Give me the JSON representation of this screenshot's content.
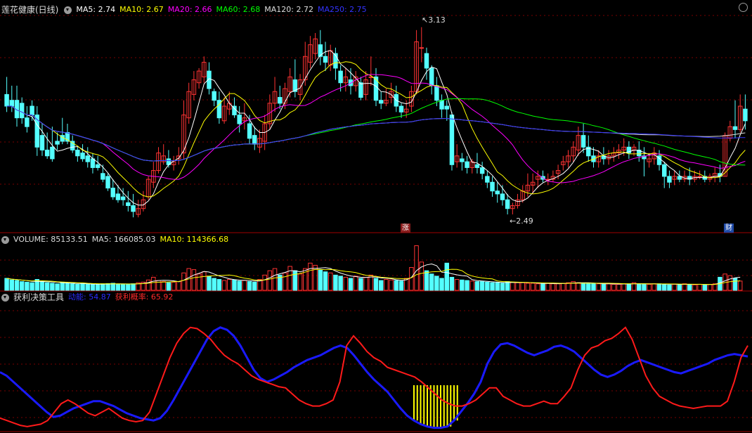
{
  "price_panel": {
    "stock_name": "莲花健康(日线)",
    "ma_legend": [
      {
        "label": "MA5: 2.74",
        "color": "#ffffff"
      },
      {
        "label": "MA10: 2.67",
        "color": "#ffff00"
      },
      {
        "label": "MA20: 2.66",
        "color": "#ff00ff"
      },
      {
        "label": "MA60: 2.68",
        "color": "#00ff00"
      },
      {
        "label": "MA120: 2.72",
        "color": "#dddddd"
      },
      {
        "label": "MA250: 2.75",
        "color": "#3333ff"
      }
    ],
    "high_label": "3.13",
    "low_label": "2.49",
    "badge_up": "涨",
    "badge_fin": "财"
  },
  "volume_panel": {
    "title": "VOLUME: 85133.51",
    "ma5": "MA5: 166085.03",
    "ma10": "MA10: 114366.68"
  },
  "indicator_panel": {
    "title": "获利决策工具",
    "momentum": "动能: 54.87",
    "profit_prob": "获利概率: 65.92"
  },
  "colors": {
    "up": "#ff3333",
    "down": "#54ffff",
    "grid": "#7a0000",
    "blue_line": "#1a1aff",
    "red_line": "#ff1a1a",
    "signal": "#ffff00"
  },
  "chart_data": {
    "type": "candlestick",
    "price_ylim": [
      2.43,
      3.17
    ],
    "volume_ymax": 420000,
    "osc_ylim": [
      0,
      100
    ],
    "candles": [
      [
        2.9,
        2.96,
        2.86,
        2.84
      ],
      [
        2.88,
        2.93,
        2.86,
        2.84
      ],
      [
        2.88,
        2.93,
        2.82,
        2.79
      ],
      [
        2.87,
        2.89,
        2.82,
        2.8
      ],
      [
        2.82,
        2.86,
        2.79,
        2.77
      ],
      [
        2.86,
        2.88,
        2.83,
        2.81
      ],
      [
        2.83,
        2.86,
        2.72,
        2.69
      ],
      [
        2.76,
        2.8,
        2.71,
        2.69
      ],
      [
        2.71,
        2.77,
        2.69,
        2.68
      ],
      [
        2.72,
        2.79,
        2.68,
        2.67
      ],
      [
        2.74,
        2.77,
        2.73,
        2.71
      ],
      [
        2.76,
        2.82,
        2.74,
        2.73
      ],
      [
        2.77,
        2.8,
        2.74,
        2.73
      ],
      [
        2.74,
        2.76,
        2.71,
        2.7
      ],
      [
        2.71,
        2.72,
        2.69,
        2.67
      ],
      [
        2.7,
        2.73,
        2.68,
        2.67
      ],
      [
        2.69,
        2.72,
        2.67,
        2.65
      ],
      [
        2.68,
        2.7,
        2.65,
        2.63
      ],
      [
        2.66,
        2.69,
        2.65,
        2.64
      ],
      [
        2.63,
        2.66,
        2.61,
        2.6
      ],
      [
        2.62,
        2.63,
        2.58,
        2.57
      ],
      [
        2.58,
        2.61,
        2.55,
        2.54
      ],
      [
        2.56,
        2.59,
        2.54,
        2.53
      ],
      [
        2.55,
        2.58,
        2.54,
        2.52
      ],
      [
        2.53,
        2.57,
        2.52,
        2.5
      ],
      [
        2.52,
        2.56,
        2.5,
        2.48
      ],
      [
        2.49,
        2.54,
        2.51,
        2.48
      ],
      [
        2.51,
        2.57,
        2.54,
        2.5
      ],
      [
        2.55,
        2.62,
        2.61,
        2.54
      ],
      [
        2.6,
        2.67,
        2.64,
        2.58
      ],
      [
        2.64,
        2.72,
        2.7,
        2.63
      ],
      [
        2.67,
        2.73,
        2.69,
        2.66
      ],
      [
        2.68,
        2.71,
        2.66,
        2.65
      ],
      [
        2.66,
        2.69,
        2.67,
        2.64
      ],
      [
        2.68,
        2.72,
        2.69,
        2.66
      ],
      [
        2.7,
        2.88,
        2.83,
        2.68
      ],
      [
        2.82,
        2.94,
        2.91,
        2.8
      ],
      [
        2.9,
        2.98,
        2.95,
        2.88
      ],
      [
        2.94,
        2.99,
        2.98,
        2.92
      ],
      [
        2.96,
        3.03,
        3.01,
        2.94
      ],
      [
        2.98,
        3.01,
        2.92,
        2.9
      ],
      [
        2.91,
        2.92,
        2.88,
        2.86
      ],
      [
        2.88,
        2.91,
        2.82,
        2.8
      ],
      [
        2.81,
        2.89,
        2.86,
        2.8
      ],
      [
        2.85,
        2.91,
        2.87,
        2.83
      ],
      [
        2.86,
        2.89,
        2.83,
        2.82
      ],
      [
        2.83,
        2.86,
        2.8,
        2.77
      ],
      [
        2.81,
        2.87,
        2.82,
        2.78
      ],
      [
        2.8,
        2.83,
        2.75,
        2.73
      ],
      [
        2.76,
        2.79,
        2.73,
        2.71
      ],
      [
        2.72,
        2.78,
        2.75,
        2.7
      ],
      [
        2.74,
        2.83,
        2.8,
        2.71
      ],
      [
        2.8,
        2.9,
        2.87,
        2.78
      ],
      [
        2.87,
        2.96,
        2.91,
        2.84
      ],
      [
        2.89,
        2.93,
        2.87,
        2.85
      ],
      [
        2.87,
        2.94,
        2.92,
        2.85
      ],
      [
        2.91,
        2.99,
        2.96,
        2.89
      ],
      [
        2.95,
        3.02,
        2.91,
        2.89
      ],
      [
        2.9,
        2.97,
        2.95,
        2.88
      ],
      [
        2.95,
        3.08,
        3.03,
        2.93
      ],
      [
        3.01,
        3.1,
        3.07,
        2.99
      ],
      [
        3.04,
        3.11,
        3.09,
        3.02
      ],
      [
        3.07,
        3.12,
        3.03,
        3.0
      ],
      [
        3.03,
        3.08,
        3.01,
        2.98
      ],
      [
        3.0,
        3.07,
        3.05,
        2.98
      ],
      [
        3.04,
        3.06,
        2.99,
        2.95
      ],
      [
        2.98,
        3.0,
        2.94,
        2.91
      ],
      [
        2.94,
        2.99,
        2.96,
        2.91
      ],
      [
        2.95,
        2.99,
        2.93,
        2.9
      ],
      [
        2.93,
        2.98,
        2.96,
        2.91
      ],
      [
        2.94,
        2.96,
        2.89,
        2.88
      ],
      [
        2.9,
        2.98,
        2.95,
        2.88
      ],
      [
        2.96,
        3.03,
        2.96,
        2.93
      ],
      [
        2.96,
        2.99,
        2.88,
        2.86
      ],
      [
        2.88,
        2.91,
        2.87,
        2.85
      ],
      [
        2.87,
        2.92,
        2.88,
        2.86
      ],
      [
        2.89,
        2.94,
        2.91,
        2.87
      ],
      [
        2.9,
        2.93,
        2.86,
        2.84
      ],
      [
        2.86,
        2.87,
        2.84,
        2.82
      ],
      [
        2.84,
        2.88,
        2.85,
        2.82
      ],
      [
        2.86,
        2.93,
        2.91,
        2.84
      ],
      [
        2.91,
        3.12,
        3.08,
        2.9
      ],
      [
        3.06,
        3.13,
        3.06,
        3.01
      ],
      [
        3.04,
        3.06,
        2.99,
        2.95
      ],
      [
        2.99,
        3.0,
        2.93,
        2.9
      ],
      [
        2.93,
        2.96,
        2.88,
        2.86
      ],
      [
        2.88,
        2.9,
        2.85,
        2.82
      ],
      [
        2.86,
        2.88,
        2.85,
        2.81
      ],
      [
        2.83,
        2.84,
        2.66,
        2.64
      ],
      [
        2.67,
        2.73,
        2.69,
        2.65
      ],
      [
        2.68,
        2.7,
        2.67,
        2.64
      ],
      [
        2.67,
        2.69,
        2.65,
        2.63
      ],
      [
        2.65,
        2.68,
        2.67,
        2.63
      ],
      [
        2.66,
        2.7,
        2.65,
        2.63
      ],
      [
        2.65,
        2.67,
        2.63,
        2.61
      ],
      [
        2.62,
        2.64,
        2.6,
        2.58
      ],
      [
        2.6,
        2.62,
        2.57,
        2.55
      ],
      [
        2.57,
        2.6,
        2.56,
        2.53
      ],
      [
        2.56,
        2.59,
        2.54,
        2.52
      ],
      [
        2.54,
        2.56,
        2.51,
        2.49
      ],
      [
        2.51,
        2.53,
        2.52,
        2.49
      ],
      [
        2.52,
        2.56,
        2.54,
        2.51
      ],
      [
        2.54,
        2.59,
        2.57,
        2.53
      ],
      [
        2.57,
        2.63,
        2.59,
        2.55
      ],
      [
        2.59,
        2.63,
        2.6,
        2.56
      ],
      [
        2.61,
        2.64,
        2.62,
        2.58
      ],
      [
        2.62,
        2.64,
        2.61,
        2.6
      ],
      [
        2.61,
        2.63,
        2.61,
        2.59
      ],
      [
        2.61,
        2.64,
        2.62,
        2.6
      ],
      [
        2.63,
        2.66,
        2.64,
        2.61
      ],
      [
        2.66,
        2.69,
        2.67,
        2.64
      ],
      [
        2.67,
        2.71,
        2.69,
        2.65
      ],
      [
        2.69,
        2.74,
        2.72,
        2.67
      ],
      [
        2.71,
        2.79,
        2.76,
        2.69
      ],
      [
        2.76,
        2.8,
        2.72,
        2.7
      ],
      [
        2.72,
        2.76,
        2.69,
        2.67
      ],
      [
        2.69,
        2.72,
        2.67,
        2.65
      ],
      [
        2.67,
        2.71,
        2.69,
        2.65
      ],
      [
        2.69,
        2.72,
        2.68,
        2.66
      ],
      [
        2.68,
        2.71,
        2.69,
        2.66
      ],
      [
        2.69,
        2.72,
        2.7,
        2.67
      ],
      [
        2.7,
        2.73,
        2.71,
        2.68
      ],
      [
        2.71,
        2.75,
        2.72,
        2.69
      ],
      [
        2.72,
        2.74,
        2.7,
        2.68
      ],
      [
        2.71,
        2.73,
        2.72,
        2.69
      ],
      [
        2.71,
        2.74,
        2.69,
        2.67
      ],
      [
        2.69,
        2.72,
        2.68,
        2.62
      ],
      [
        2.67,
        2.7,
        2.68,
        2.65
      ],
      [
        2.68,
        2.72,
        2.7,
        2.66
      ],
      [
        2.69,
        2.71,
        2.66,
        2.64
      ],
      [
        2.66,
        2.67,
        2.62,
        2.58
      ],
      [
        2.62,
        2.64,
        2.6,
        2.58
      ],
      [
        2.61,
        2.64,
        2.62,
        2.59
      ],
      [
        2.62,
        2.64,
        2.61,
        2.6
      ],
      [
        2.61,
        2.64,
        2.62,
        2.6
      ],
      [
        2.62,
        2.65,
        2.61,
        2.59
      ],
      [
        2.61,
        2.64,
        2.62,
        2.6
      ],
      [
        2.62,
        2.64,
        2.62,
        2.61
      ],
      [
        2.62,
        2.64,
        2.61,
        2.6
      ],
      [
        2.61,
        2.63,
        2.62,
        2.6
      ],
      [
        2.62,
        2.65,
        2.63,
        2.6
      ],
      [
        2.63,
        2.66,
        2.62,
        2.6
      ],
      [
        2.62,
        2.77,
        2.76,
        2.62
      ],
      [
        2.75,
        2.81,
        2.79,
        2.74
      ],
      [
        2.79,
        2.88,
        2.78,
        2.75
      ],
      [
        2.78,
        2.9,
        2.86,
        2.77
      ],
      [
        2.85,
        2.9,
        2.81,
        2.78
      ]
    ],
    "volume": [
      110000,
      95000,
      90000,
      80000,
      75000,
      70000,
      100000,
      80000,
      70000,
      65000,
      60000,
      75000,
      65000,
      60000,
      55000,
      58000,
      60000,
      55000,
      52000,
      60000,
      62000,
      65000,
      58000,
      55000,
      55000,
      60000,
      70000,
      75000,
      95000,
      120000,
      90000,
      80000,
      70000,
      75000,
      80000,
      160000,
      200000,
      190000,
      150000,
      170000,
      130000,
      110000,
      100000,
      90000,
      100000,
      95000,
      85000,
      90000,
      80000,
      75000,
      100000,
      140000,
      180000,
      200000,
      140000,
      160000,
      220000,
      180000,
      150000,
      200000,
      250000,
      230000,
      190000,
      170000,
      160000,
      140000,
      130000,
      120000,
      110000,
      130000,
      110000,
      120000,
      140000,
      110000,
      90000,
      100000,
      95000,
      90000,
      85000,
      110000,
      210000,
      410000,
      260000,
      180000,
      150000,
      130000,
      110000,
      250000,
      120000,
      100000,
      95000,
      90000,
      85000,
      80000,
      80000,
      75000,
      70000,
      70000,
      65000,
      80000,
      75000,
      70000,
      70000,
      65000,
      65000,
      60000,
      60000,
      65000,
      60000,
      60000,
      65000,
      70000,
      80000,
      70000,
      65000,
      60000,
      60000,
      60000,
      60000,
      60000,
      55000,
      55000,
      60000,
      60000,
      70000,
      60000,
      55000,
      55000,
      60000,
      60000,
      55000,
      50000,
      55000,
      55000,
      60000,
      55000,
      50000,
      55000,
      50000,
      55000,
      60000,
      120000,
      150000,
      135000,
      110000,
      85000
    ],
    "momentum": [
      48,
      45,
      40,
      35,
      30,
      25,
      20,
      15,
      11,
      12,
      15,
      18,
      20,
      22,
      24,
      24,
      22,
      20,
      17,
      14,
      12,
      10,
      9,
      8,
      10,
      16,
      25,
      35,
      45,
      55,
      65,
      75,
      82,
      85,
      83,
      78,
      70,
      60,
      50,
      43,
      40,
      42,
      45,
      48,
      52,
      55,
      58,
      60,
      62,
      65,
      68,
      70,
      68,
      62,
      55,
      48,
      42,
      37,
      32,
      25,
      18,
      12,
      8,
      5,
      3,
      2,
      2,
      3,
      8,
      15,
      22,
      30,
      40,
      55,
      65,
      71,
      72,
      70,
      67,
      64,
      62,
      64,
      66,
      69,
      70,
      68,
      65,
      60,
      55,
      50,
      46,
      44,
      46,
      49,
      53,
      56,
      58,
      56,
      54,
      52,
      50,
      48,
      47,
      49,
      51,
      53,
      55,
      58,
      60,
      62,
      63,
      62,
      61
    ],
    "profit_prob": [
      10,
      8,
      6,
      4,
      3,
      4,
      5,
      8,
      15,
      22,
      25,
      22,
      18,
      14,
      12,
      15,
      18,
      14,
      10,
      8,
      7,
      8,
      15,
      30,
      45,
      60,
      72,
      80,
      85,
      84,
      80,
      75,
      68,
      62,
      58,
      55,
      50,
      45,
      42,
      40,
      38,
      36,
      35,
      30,
      25,
      22,
      20,
      20,
      22,
      25,
      40,
      70,
      78,
      72,
      65,
      60,
      57,
      52,
      50,
      48,
      46,
      44,
      40,
      35,
      30,
      25,
      22,
      20,
      20,
      22,
      25,
      30,
      35,
      35,
      28,
      25,
      22,
      20,
      20,
      22,
      24,
      22,
      22,
      28,
      35,
      50,
      62,
      68,
      70,
      74,
      76,
      80,
      85,
      75,
      60,
      45,
      35,
      28,
      25,
      22,
      20,
      19,
      18,
      19,
      20,
      20,
      20,
      24,
      40,
      60,
      70
    ]
  }
}
